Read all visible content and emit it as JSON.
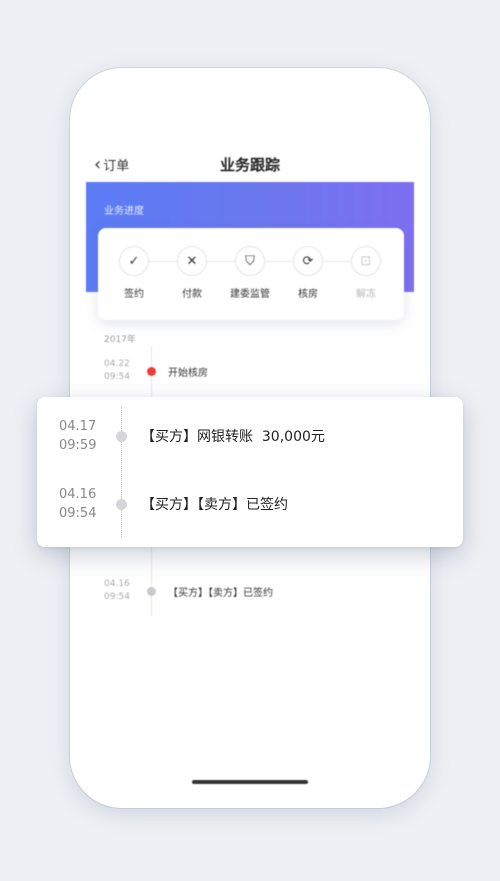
{
  "header": {
    "back_label": "订单",
    "back_icon": "chevron-left-icon",
    "title": "业务跟踪"
  },
  "banner": {
    "label": "业务进度"
  },
  "steps": [
    {
      "label": "签约",
      "icon": "✓",
      "icon_name": "check-icon",
      "disabled": false
    },
    {
      "label": "付款",
      "icon": "✕",
      "icon_name": "close-icon",
      "disabled": false
    },
    {
      "label": "建委监管",
      "icon": "⛉",
      "icon_name": "shield-icon",
      "disabled": false
    },
    {
      "label": "核房",
      "icon": "⟳",
      "icon_name": "refresh-icon",
      "disabled": false
    },
    {
      "label": "解冻",
      "icon": "⊡",
      "icon_name": "unlock-icon",
      "disabled": true
    }
  ],
  "timeline": {
    "year": "2017年",
    "items": [
      {
        "date": "04.22",
        "time": "09:54",
        "text": "开始核房",
        "active": true
      },
      {
        "date": "04.16",
        "time": "09:54",
        "text": "【买方】【卖方】已签约",
        "active": false
      }
    ]
  },
  "overlay": {
    "items": [
      {
        "date": "04.17",
        "time": "09:59",
        "text": "【买方】网银转账  30,000元"
      },
      {
        "date": "04.16",
        "time": "09:54",
        "text": "【买方】【卖方】已签约"
      }
    ]
  },
  "colors": {
    "accent_start": "#5b7cf5",
    "accent_end": "#7e6ff0",
    "active_dot": "#f03a3a"
  }
}
